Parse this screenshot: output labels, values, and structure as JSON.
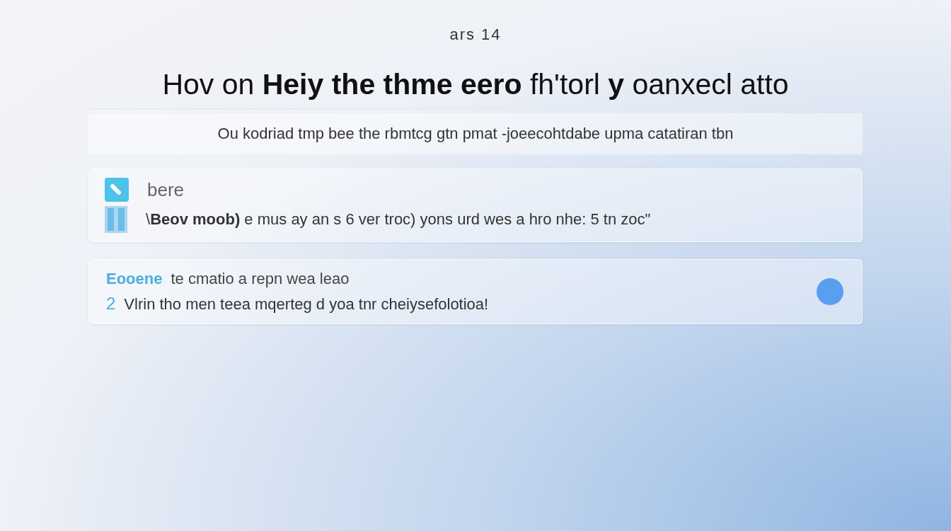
{
  "header": {
    "eyebrow": "ars 14",
    "title": "Hov on **Heiy the thme eero** fh'torl **y** oanxecl atto",
    "subtitle": "Ou kodriad tmp bee the rbmtcg gtn pmat -joeecohtdabe upma catatiran tbn"
  },
  "cards": [
    {
      "kind": "note",
      "label": "bere",
      "text": "\\**Beov moob)** e mus ay an s 6 ver troc) yons urd wes a hro nhe: 5 tn zoc\""
    },
    {
      "kind": "tip",
      "label": "Eooene",
      "caption": "te cmatio a repn wea leao",
      "number": "2",
      "text": "Vlrin tho men teea mqerteg d yoa tnr cheiysefolotioa!"
    }
  ]
}
